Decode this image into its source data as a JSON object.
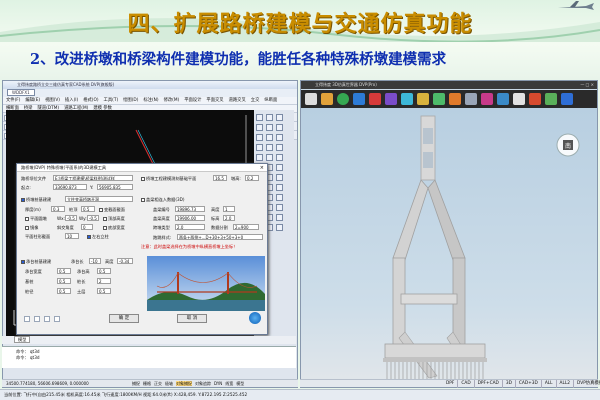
{
  "slide": {
    "title": "四、扩展路桥建模与交通仿真功能",
    "subtitle": "2、改进桥墩和桥梁构件建模功能，能胜任各种特殊桥墩建模需求"
  },
  "left_app": {
    "window_title": "立得纬度路桥立交三维仿真专家CAD系统 DVP(旗舰版)",
    "doc_tab": "WDDFX1",
    "menu": [
      "文件(F)",
      "编辑(E)",
      "视图(V)",
      "插入(I)",
      "格式(O)",
      "工具(T)",
      "绘图(D)",
      "标注(N)",
      "修改(M)",
      "平面设计",
      "平面交叉",
      "道路交叉",
      "立交",
      "纵断面",
      "横断面",
      "桥梁",
      "隧道(DTM)",
      "道路工程(M)",
      "建模 参数"
    ],
    "layer_value": "ByLayer",
    "dialog": {
      "title": "路桥墩(DVP) 特殊桥墩(平面系)的3D建模工具",
      "label_file": "路桥坝位文件",
      "file_value": "E:\\桥梁工程建模\\桥梁样例\\测试样",
      "label_start": "起点:",
      "start_value": "33690.873",
      "label_y": "Y:",
      "y_value": "56905.835",
      "check_pier": "桥墩桩基建建",
      "pier_option": "立柱变高桥墩开洞",
      "label_thick": "厚度(m)",
      "thick_value": "0.3",
      "label_height": "桩顶",
      "height_value": "0.5",
      "check_section": "平面圆墩",
      "check_mirror": "镜像",
      "label_wx": "Wx:",
      "wx_value": "-0.5",
      "label_wy": "Wy:",
      "wy_value": "-0.5",
      "check_variable": "变截面截面",
      "check_outer": "顶部高度",
      "label_angle": "斜交角度",
      "angle_value": "0",
      "label_section_num": "平面柱形截面",
      "section_value": "10",
      "check_lower": "底部宽度",
      "check_lr": "左右立柱",
      "right_check_main": "桥墩工程建模测刻基础平面",
      "right_value1": "16.5",
      "right_label_pier": "墩高:",
      "right_value2": "0.2",
      "right_check_cap": "盖梁相连入数据(3D)",
      "right_label_dist": "盖梁编号",
      "right_value3": "19896.73",
      "right_label_h": "高度",
      "right_value4": "1",
      "right_label_hh": "盖梁高度",
      "right_value5": "19906.00",
      "right_label_t": "标高",
      "right_value6": "2.0",
      "right_label_type": "跨墩类型",
      "right_value7": "2.0",
      "right_label_s": "数据分割",
      "right_value8": "2=900",
      "right_label_fn": "跑跳样式:",
      "right_value9": "两条+两侧+...D+30+3+50+3+0",
      "right_note": "注意：此时盖梁选择在为桥墩中纵横直桥墩上坐标！",
      "check_base": "承台桩基建建",
      "base_label1": "承台长",
      "base_value1": "-10",
      "base_label2": "高度",
      "base_value2": "-0.34",
      "base_label3": "承台宽度",
      "base_value3": "0.5",
      "base_label4": "承台高",
      "base_value4": "0.5",
      "base_label5": "基桩",
      "base_value5": "0.5",
      "base_label6": "桩长",
      "base_value6": "2",
      "base_label7": "桩径",
      "base_value7": "0.5",
      "base_label8": "土层",
      "base_value8": "0.5",
      "ok": "确 定",
      "cancel": "取 消"
    },
    "tab_label": "模型",
    "cmd_lines": [
      "命令：  qt3d",
      "命令：  qt3d"
    ],
    "status": "34500.774180,  56606.698609,  0.000000",
    "status_buttons": [
      "捕捉",
      "栅格",
      "正交",
      "极轴",
      "对象捕捉",
      "对象追踪",
      "DYN",
      "线宽",
      "模型"
    ]
  },
  "right_app": {
    "window_title": "立得纬度 3D仿真世界器 DVP(Pro)",
    "status_items": [
      "DPF",
      "CAD",
      "DPF+CAD",
      "3D",
      "CAD+3D",
      "ALL",
      "ALL2",
      "DVP仿真模拟"
    ]
  },
  "bottom_bar": "当前位置: 飞行中(自由215.45米  相机高度:16.45米  飞行速度:1800KM/H  视距:64.0米(ft)  X:428,459.  Y:8722.195  Z:2525.452"
}
